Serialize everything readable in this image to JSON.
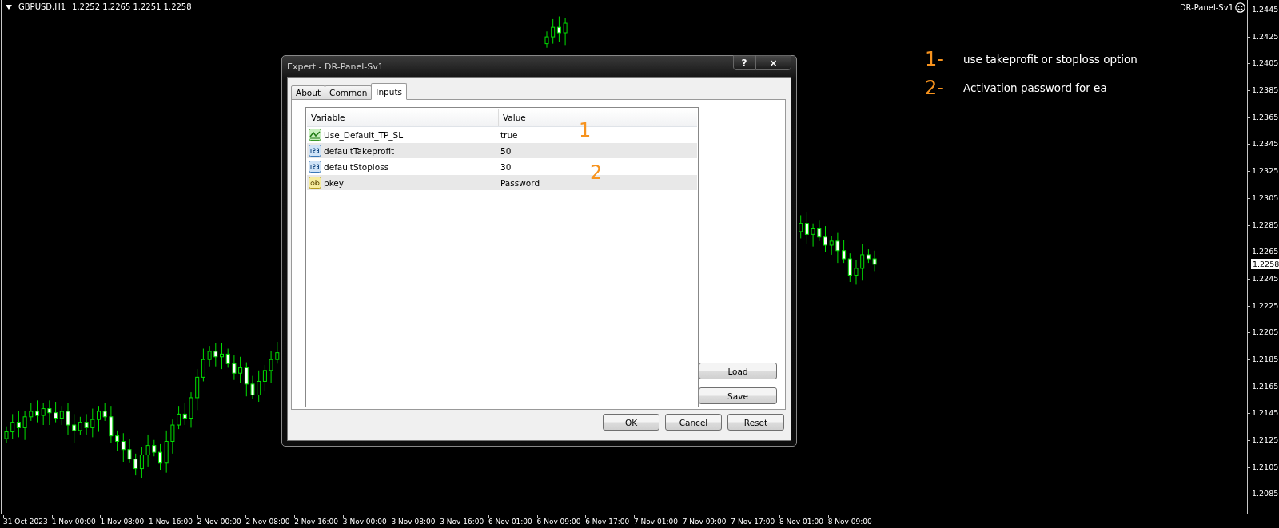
{
  "chart_header": {
    "symbol": "GBPUSD,H1",
    "ohlc": "1.2252 1.2265 1.2251 1.2258"
  },
  "expert_label": "DR-Panel-Sv1",
  "price_axis": {
    "labels": [
      "1.2445",
      "1.2425",
      "1.2405",
      "1.2385",
      "1.2365",
      "1.2345",
      "1.2325",
      "1.2305",
      "1.2285",
      "1.2265",
      "1.2245",
      "1.2225",
      "1.2205",
      "1.2185",
      "1.2165",
      "1.2145",
      "1.2125",
      "1.2105",
      "1.2085"
    ],
    "current_price": "1.2258"
  },
  "time_axis": {
    "labels": [
      "31 Oct 2023",
      "1 Nov 00:00",
      "1 Nov 08:00",
      "1 Nov 16:00",
      "2 Nov 00:00",
      "2 Nov 08:00",
      "2 Nov 16:00",
      "3 Nov 00:00",
      "3 Nov 08:00",
      "3 Nov 16:00",
      "6 Nov 01:00",
      "6 Nov 09:00",
      "6 Nov 17:00",
      "7 Nov 01:00",
      "7 Nov 09:00",
      "7 Nov 17:00",
      "8 Nov 01:00",
      "8 Nov 09:00"
    ]
  },
  "notes": [
    {
      "number": "1-",
      "text": "use takeprofit or stoploss option"
    },
    {
      "number": "2-",
      "text": "Activation password for ea"
    }
  ],
  "dialog": {
    "title": "Expert - DR-Panel-Sv1",
    "title_buttons": [
      "?",
      "×"
    ],
    "tabs": [
      {
        "label": "About",
        "selected": false
      },
      {
        "label": "Common",
        "selected": false
      },
      {
        "label": "Inputs",
        "selected": true
      }
    ],
    "table": {
      "columns": [
        "Variable",
        "Value"
      ],
      "rows": [
        {
          "kind": "bool",
          "variable": "Use_Default_TP_SL",
          "value": "true"
        },
        {
          "kind": "number",
          "variable": "defaultTakeprofit",
          "value": "50"
        },
        {
          "kind": "number",
          "variable": "defaultStoploss",
          "value": "30"
        },
        {
          "kind": "string",
          "variable": "pkey",
          "value": "Password"
        }
      ]
    },
    "markers": [
      "1",
      "2"
    ],
    "side_buttons": [
      "Load",
      "Save"
    ],
    "buttons": [
      "OK",
      "Cancel",
      "Reset"
    ]
  }
}
